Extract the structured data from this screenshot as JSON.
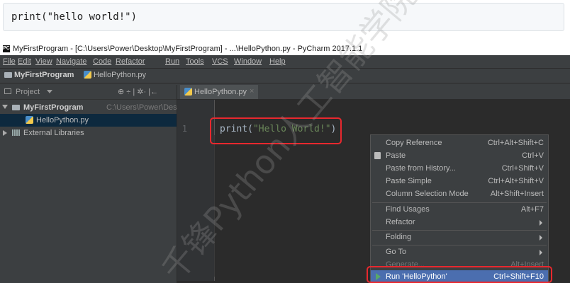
{
  "snippet": {
    "code": "print(\"hello world!\")"
  },
  "window": {
    "title": "MyFirstProgram - [C:\\Users\\Power\\Desktop\\MyFirstProgram] - ...\\HelloPython.py - PyCharm 2017.1.1",
    "app_icon_text": "PC"
  },
  "menu": [
    "File",
    "Edit",
    "View",
    "Navigate",
    "Code",
    "Refactor",
    "Run",
    "Tools",
    "VCS",
    "Window",
    "Help"
  ],
  "breadcrumb": {
    "project": "MyFirstProgram",
    "file": "HelloPython.py"
  },
  "project_panel": {
    "header": "Project",
    "header_tools": "⊕ ÷ | ✲· |←",
    "root_name": "MyFirstProgram",
    "root_path": "C:\\Users\\Power\\Desktop\\",
    "file": "HelloPython.py",
    "external": "External Libraries"
  },
  "editor": {
    "tab": "HelloPython.py",
    "line_number": "1",
    "code_func": "print(",
    "code_string": "\"Hello World!\"",
    "code_close": ")"
  },
  "context_menu": {
    "items": [
      {
        "label": "Copy Reference",
        "shortcut": "Ctrl+Alt+Shift+C"
      },
      {
        "label": "Paste",
        "shortcut": "Ctrl+V"
      },
      {
        "label": "Paste from History...",
        "shortcut": "Ctrl+Shift+V"
      },
      {
        "label": "Paste Simple",
        "shortcut": "Ctrl+Alt+Shift+V"
      },
      {
        "label": "Column Selection Mode",
        "shortcut": "Alt+Shift+Insert"
      },
      {
        "label": "Find Usages",
        "shortcut": "Alt+F7"
      },
      {
        "label": "Refactor",
        "shortcut": ""
      },
      {
        "label": "Folding",
        "shortcut": ""
      },
      {
        "label": "Go To",
        "shortcut": ""
      },
      {
        "label": "Generate...",
        "shortcut": "Alt+Insert"
      },
      {
        "label": "Run 'HelloPython'",
        "shortcut": "Ctrl+Shift+F10"
      }
    ]
  },
  "watermark": {
    "text": "千锋Python人工智能学院"
  },
  "colors": {
    "highlight": "#e8282e",
    "run_bg": "#4b6eaf",
    "string": "#6a8759"
  }
}
